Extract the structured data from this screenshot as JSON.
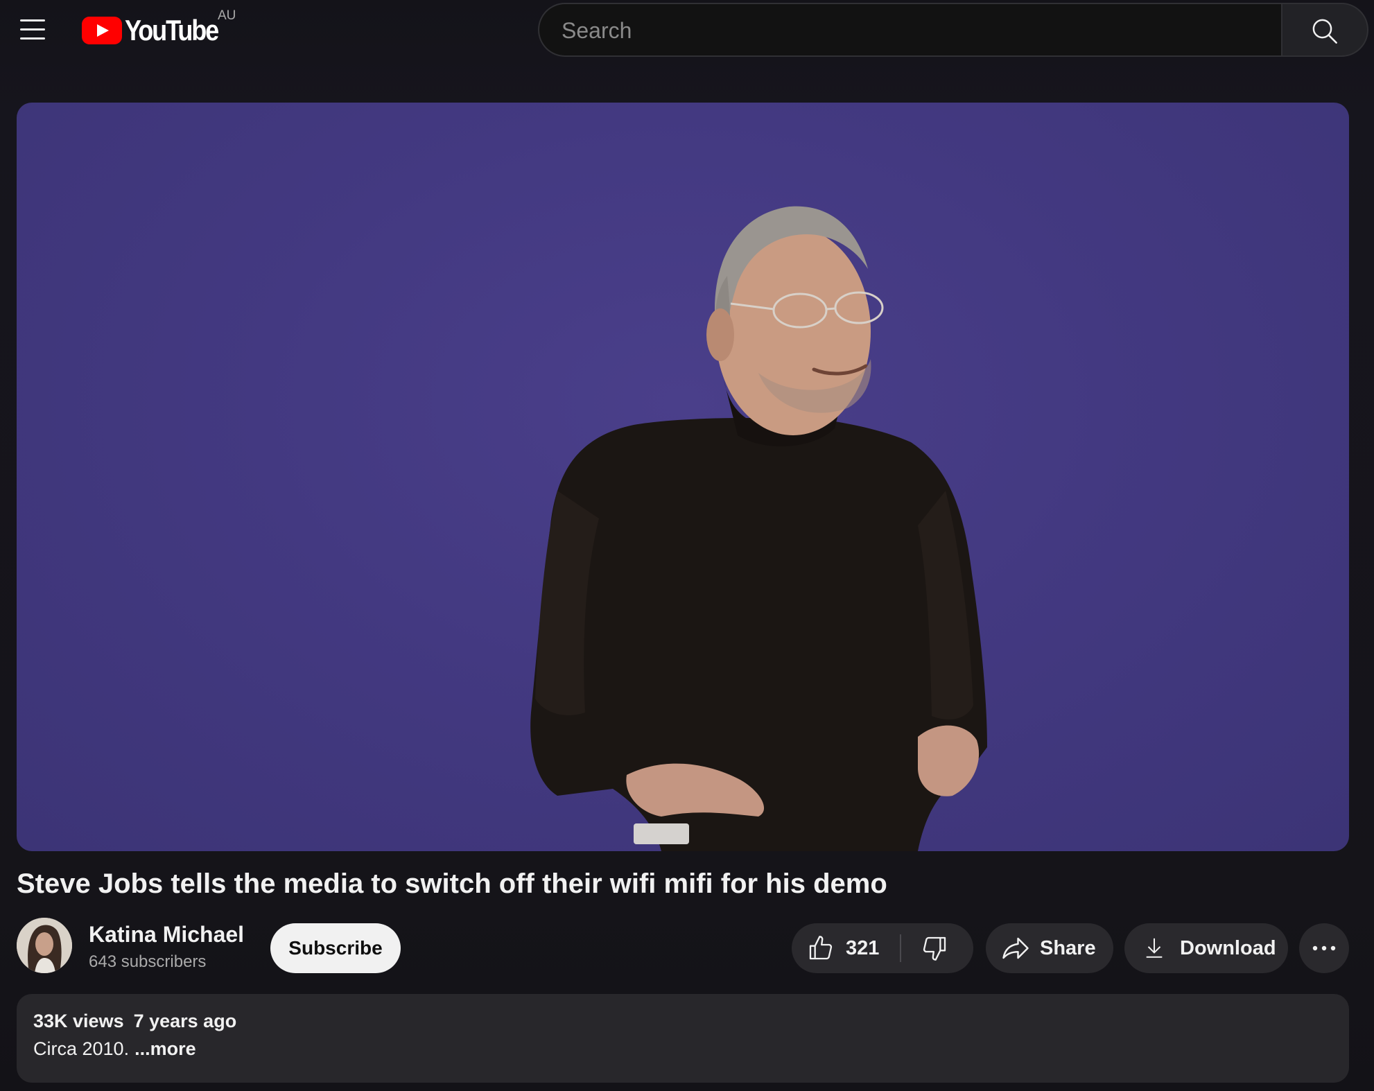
{
  "header": {
    "logo_text": "YouTube",
    "country_code": "AU",
    "search_placeholder": "Search"
  },
  "video": {
    "title": "Steve Jobs tells the media to switch off their wifi mifi for his demo"
  },
  "owner": {
    "channel_name": "Katina Michael",
    "subscriber_count": "643 subscribers",
    "subscribe_label": "Subscribe"
  },
  "actions": {
    "like_count": "321",
    "share_label": "Share",
    "download_label": "Download"
  },
  "description": {
    "views": "33K views",
    "date": "7 years ago",
    "text": "Circa 2010.",
    "more_label": "...more"
  },
  "colors": {
    "background": "#151419",
    "brand_red": "#ff0000",
    "player_background": "#433981",
    "pill_background": "#2a292d",
    "subscribe_background": "#f1f1f1"
  },
  "icons": {
    "menu": "hamburger-menu-icon",
    "search": "search-icon",
    "like": "thumbs-up-icon",
    "dislike": "thumbs-down-icon",
    "share": "share-arrow-icon",
    "download": "download-icon",
    "more": "more-horizontal-icon"
  }
}
